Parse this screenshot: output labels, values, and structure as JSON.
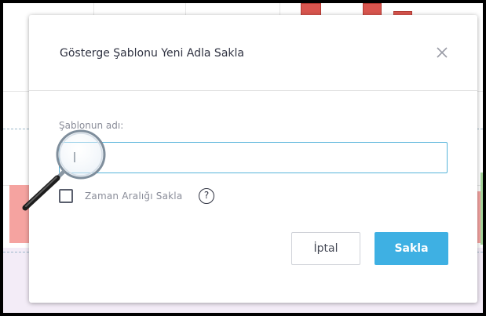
{
  "dialog": {
    "title": "Gösterge Şablonu Yeni Adla Sakla",
    "close_icon": "close-icon",
    "name_field": {
      "label": "Şablonun adı:",
      "value": "",
      "placeholder": ""
    },
    "save_interval": {
      "label": "Zaman Aralığı Sakla",
      "checked": false,
      "help_glyph": "?"
    },
    "buttons": {
      "cancel_label": "İptal",
      "save_label": "Sakla"
    }
  },
  "colors": {
    "accent": "#3eb0e3",
    "input_focus_border": "#57b4da",
    "candle_red": "#d9554e",
    "volume_pink": "#f5a3a0",
    "volume_green": "#a6d59c",
    "indicator_pane": "#f3ecf7"
  },
  "overlay": {
    "magnifier_icon": "magnifier-icon"
  }
}
